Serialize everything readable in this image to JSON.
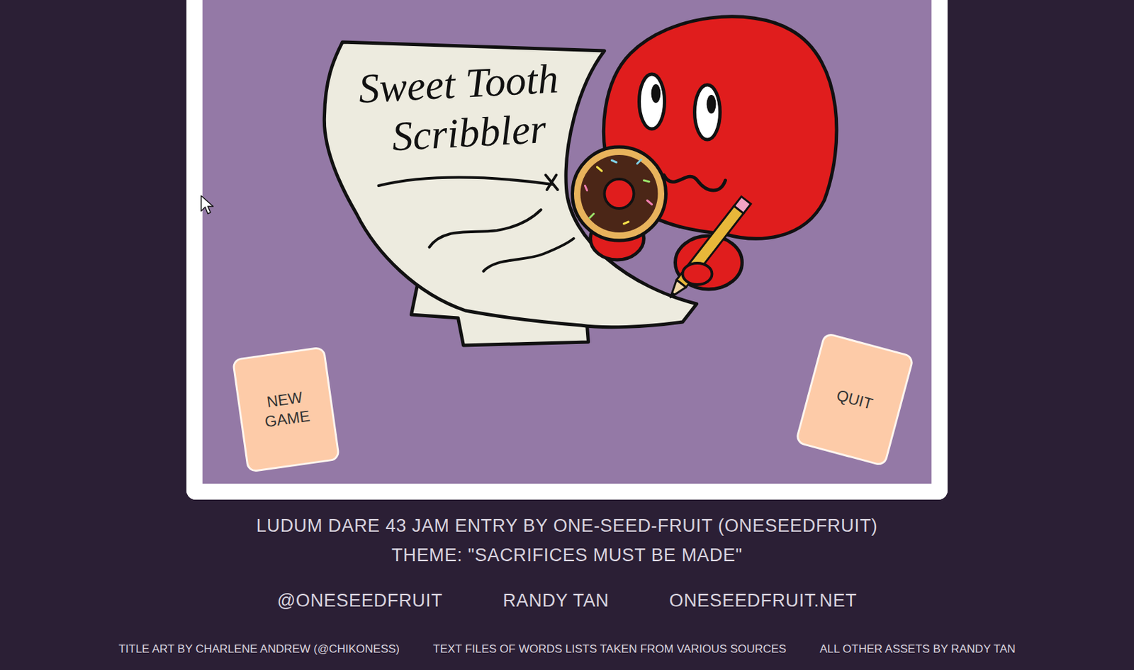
{
  "title_art": {
    "lines": [
      "Sweet Tooth",
      "Scribbler"
    ]
  },
  "menu": [
    {
      "label": "NEW GAME"
    },
    {
      "label": "QUIT"
    }
  ],
  "credits": {
    "jam": "LUDUM DARE 43 JAM ENTRY BY ONE-SEED-FRUIT (ONESEEDFRUIT)",
    "theme": "THEME: \"SACRIFICES MUST BE MADE\"",
    "links": [
      "@ONESEEDFRUIT",
      "RANDY TAN",
      "ONESEEDFRUIT.NET"
    ],
    "footer": [
      "TITLE ART BY CHARLENE ANDREW (@CHIKONESS)",
      "TEXT FILES OF WORDS LISTS TAKEN FROM VARIOUS SOURCES",
      "ALL OTHER ASSETS BY RANDY TAN"
    ]
  }
}
